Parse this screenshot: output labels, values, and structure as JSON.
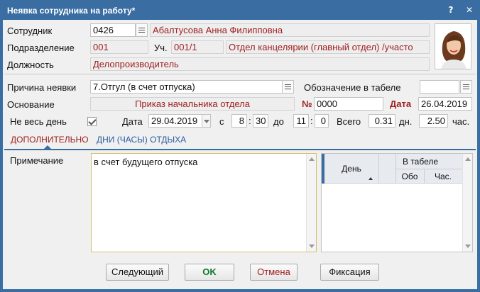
{
  "window": {
    "title": "Неявка сотрудника на работу*",
    "help": "?",
    "close": "✕"
  },
  "employee": {
    "label": "Сотрудник",
    "code": "0426",
    "name": "Абалтусова Анна Филипповна"
  },
  "department": {
    "label": "Подразделение",
    "code": "001",
    "section_label": "Уч.",
    "section": "001/1",
    "name": "Отдел канцелярии (главный отдел) /участо"
  },
  "position": {
    "label": "Должность",
    "value": "Делопроизводитель"
  },
  "absence": {
    "reason_label": "Причина неявки",
    "reason": "7.Отгул (в счет отпуска)",
    "timesheet_label": "Обозначение в табеле",
    "timesheet_value": ""
  },
  "basis": {
    "label": "Основание",
    "value": "Приказ начальника отдела",
    "num_label": "№",
    "num": "0000",
    "date_label": "Дата",
    "date": "26.04.2019"
  },
  "partial": {
    "label": "Не весь день",
    "checked": true,
    "date_label": "Дата",
    "date": "29.04.2019",
    "from_label": "с",
    "from_h": "8",
    "from_m": "30",
    "to_label": "до",
    "to_h": "11",
    "to_m": "0",
    "total_label": "Всего",
    "days": "0.31",
    "days_unit": "дн.",
    "hours": "2.50",
    "hours_unit": "час.",
    "colon": ":"
  },
  "tabs": [
    {
      "label": "ДОПОЛНИТЕЛЬНО",
      "active": true
    },
    {
      "label": "ДНИ (ЧАСЫ) ОТДЫХА",
      "active": false
    }
  ],
  "note": {
    "label": "Примечание",
    "value": "в счет будущего отпуска"
  },
  "grid": {
    "col_day": "День",
    "group": "В табеле",
    "col_code": "Обо",
    "col_hours": "Час."
  },
  "buttons": {
    "next": "Следующий",
    "ok": "OK",
    "cancel": "Отмена",
    "fix": "Фиксация"
  },
  "colors": {
    "title_bar": "#3a6ea3",
    "accent_red": "#a02020",
    "tab_blue": "#2a5da0",
    "ok_green": "#0a7a2a"
  },
  "icons": {
    "list": "list-icon",
    "photo": "employee-photo",
    "checkbox": "checkmark-icon"
  }
}
